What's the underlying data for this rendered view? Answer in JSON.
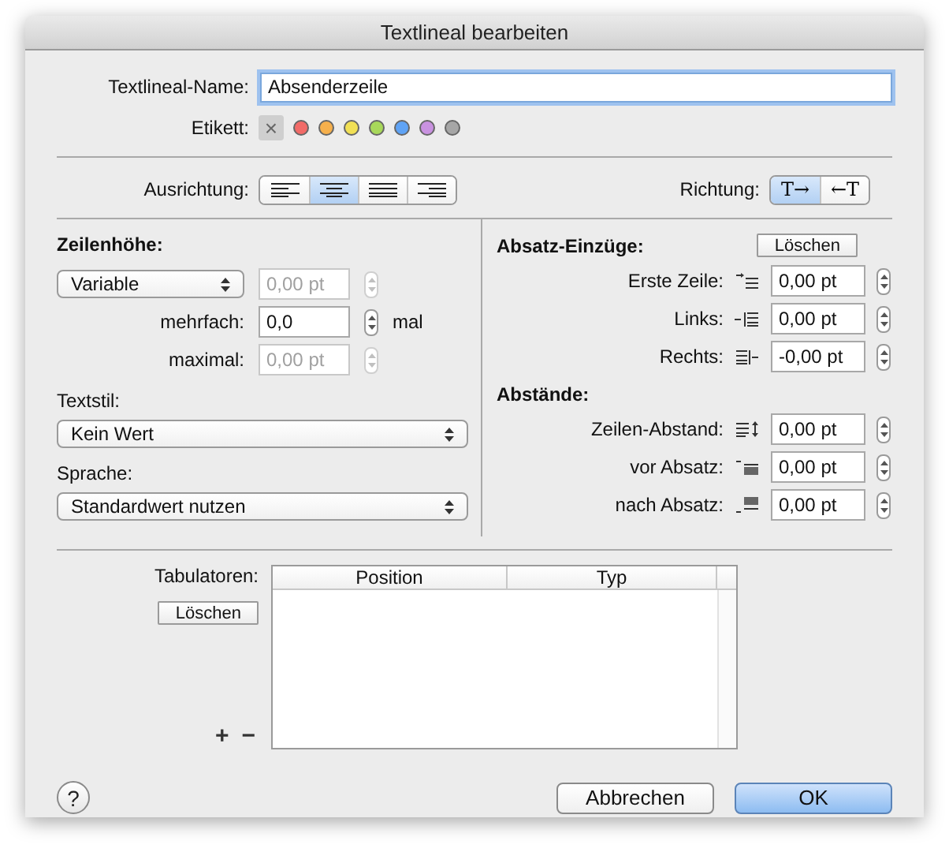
{
  "window": {
    "title": "Textlineal bearbeiten"
  },
  "name_field": {
    "label": "Textlineal-Name:",
    "value": "Absenderzeile"
  },
  "tag": {
    "label": "Etikett:",
    "options": [
      {
        "kind": "none",
        "text": "×",
        "selected": true
      },
      {
        "kind": "color",
        "color": "#f26b68",
        "selected": false
      },
      {
        "kind": "color",
        "color": "#f6b04c",
        "selected": false
      },
      {
        "kind": "color",
        "color": "#f1e055",
        "selected": false
      },
      {
        "kind": "color",
        "color": "#a8d85a",
        "selected": false
      },
      {
        "kind": "color",
        "color": "#5fa3f5",
        "selected": false
      },
      {
        "kind": "color",
        "color": "#c992e0",
        "selected": false
      },
      {
        "kind": "color",
        "color": "#a6a6a6",
        "selected": false
      }
    ]
  },
  "alignment": {
    "label": "Ausrichtung:",
    "options": [
      {
        "kind": "left",
        "selected": false
      },
      {
        "kind": "center",
        "selected": true
      },
      {
        "kind": "justify",
        "selected": false
      },
      {
        "kind": "right",
        "selected": false
      }
    ]
  },
  "direction": {
    "label": "Richtung:",
    "options": [
      {
        "text": "T→",
        "selected": true
      },
      {
        "text": "←T",
        "selected": false
      }
    ]
  },
  "line_height": {
    "heading": "Zeilenhöhe:",
    "mode": "Variable",
    "fixed": {
      "value": "0,00 pt",
      "disabled": true
    },
    "multiple": {
      "label": "mehrfach:",
      "value": "0,0",
      "unit": "mal",
      "disabled": false
    },
    "maximum": {
      "label": "maximal:",
      "value": "0,00 pt",
      "disabled": true
    }
  },
  "text_style": {
    "label": "Textstil:",
    "value": "Kein Wert"
  },
  "language": {
    "label": "Sprache:",
    "value": "Standardwert nutzen"
  },
  "indents": {
    "heading": "Absatz-Einzüge:",
    "button": "Löschen",
    "rows": [
      {
        "label": "Erste Zeile:",
        "kind": "first",
        "value": "0,00 pt"
      },
      {
        "label": "Links:",
        "kind": "left",
        "value": "0,00 pt"
      },
      {
        "label": "Rechts:",
        "kind": "right",
        "value": "-0,00 pt"
      }
    ]
  },
  "spacing": {
    "heading": "Abstände:",
    "rows": [
      {
        "label": "Zeilen-Abstand:",
        "kind": "line",
        "value": "0,00 pt"
      },
      {
        "label": "vor Absatz:",
        "kind": "before",
        "value": "0,00 pt"
      },
      {
        "label": "nach Absatz:",
        "kind": "after",
        "value": "0,00 pt"
      }
    ]
  },
  "tabs": {
    "label": "Tabulatoren:",
    "button": "Löschen",
    "columns": [
      "Position",
      "Typ"
    ],
    "add": "+",
    "remove": "−"
  },
  "help": "?",
  "buttons": [
    {
      "label": "Abbrechen",
      "default": false
    },
    {
      "label": "OK",
      "default": true
    }
  ]
}
